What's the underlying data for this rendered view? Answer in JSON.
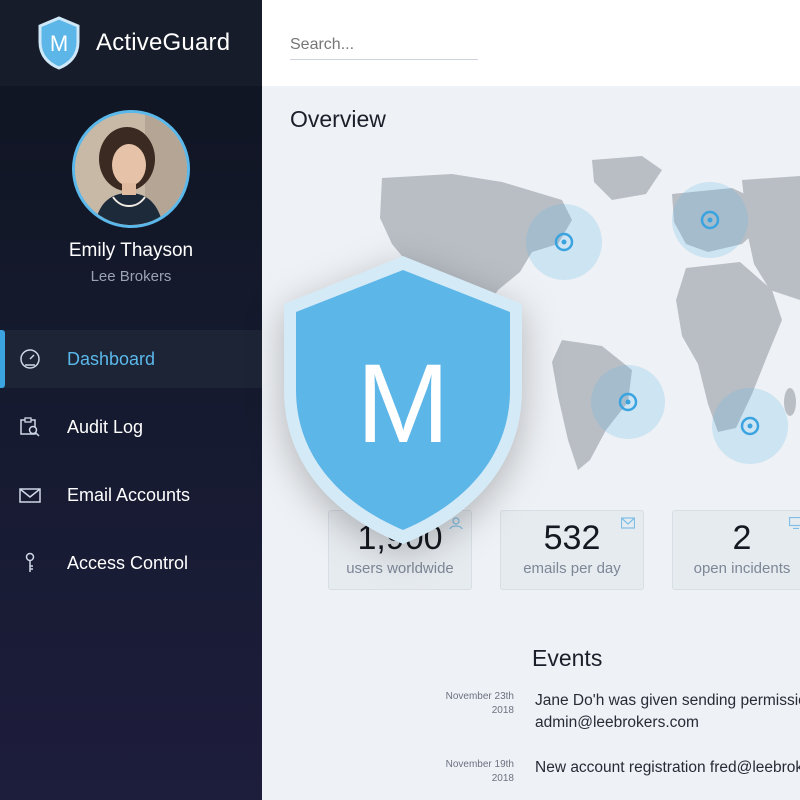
{
  "brand": {
    "name": "ActiveGuard",
    "logo_letter": "M"
  },
  "profile": {
    "name": "Emily Thayson",
    "company": "Lee Brokers"
  },
  "nav": {
    "items": [
      {
        "label": "Dashboard",
        "icon": "gauge-icon",
        "active": true
      },
      {
        "label": "Audit Log",
        "icon": "clipboard-search-icon",
        "active": false
      },
      {
        "label": "Email Accounts",
        "icon": "envelope-icon",
        "active": false
      },
      {
        "label": "Access Control",
        "icon": "key-icon",
        "active": false
      }
    ]
  },
  "search": {
    "placeholder": "Search..."
  },
  "overview": {
    "title": "Overview"
  },
  "stats": [
    {
      "value": "1,900",
      "label": "users worldwide",
      "icon": "users-icon"
    },
    {
      "value": "532",
      "label": "emails per day",
      "icon": "envelope-icon"
    },
    {
      "value": "2",
      "label": "open incidents",
      "icon": "monitor-icon"
    }
  ],
  "events": {
    "title": "Events",
    "items": [
      {
        "date_line1": "November 23th",
        "date_line2": "2018",
        "text_line1": "Jane Do'h was given sending permissions",
        "text_line2": "admin@leebrokers.com"
      },
      {
        "date_line1": "November 19th",
        "date_line2": "2018",
        "text_line1": "New account registration fred@leebrokers",
        "text_line2": ""
      }
    ]
  },
  "colors": {
    "accent": "#5bb8ea",
    "sidebar": "#151a2e",
    "shield": "#5db6e8"
  }
}
